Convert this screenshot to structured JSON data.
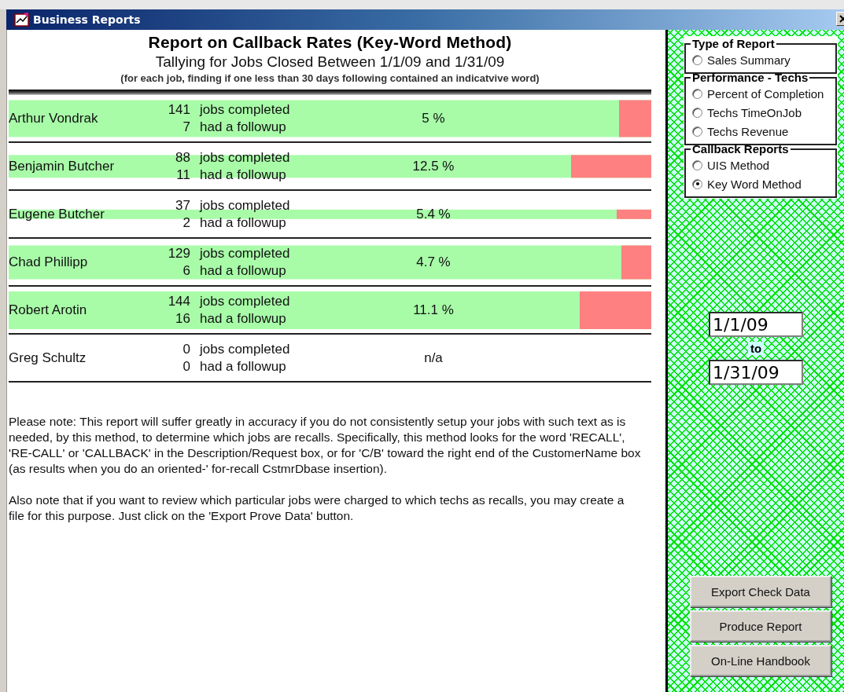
{
  "window": {
    "title": "Business Reports"
  },
  "report": {
    "title": "Report on Callback Rates (Key-Word Method)",
    "subtitle": "Tallying for Jobs Closed Between 1/1/09 and 1/31/09",
    "criteria": "(for each job, finding if one less than 30 days following contained an indicatvive word)"
  },
  "rows": [
    {
      "name": "Arthur Vondrak",
      "jobs": "141",
      "jobs_label": "jobs completed",
      "followups": "7",
      "followups_label": "had a followup",
      "rate": "5 %",
      "level": 0.05
    },
    {
      "name": "Benjamin Butcher",
      "jobs": "88",
      "jobs_label": "jobs completed",
      "followups": "11",
      "followups_label": "had a followup",
      "rate": "12.5 %",
      "level": 0.125
    },
    {
      "name": "Eugene Butcher",
      "jobs": "37",
      "jobs_label": "jobs completed",
      "followups": "2",
      "followups_label": "had a followup",
      "rate": "5.4 %",
      "level": 0.054
    },
    {
      "name": "Chad Phillipp",
      "jobs": "129",
      "jobs_label": "jobs completed",
      "followups": "6",
      "followups_label": "had a followup",
      "rate": "4.7 %",
      "level": 0.047
    },
    {
      "name": "Robert Arotin",
      "jobs": "144",
      "jobs_label": "jobs completed",
      "followups": "16",
      "followups_label": "had a followup",
      "rate": "11.1 %",
      "level": 0.111
    },
    {
      "name": "Greg Schultz",
      "jobs": "0",
      "jobs_label": "jobs completed",
      "followups": "0",
      "followups_label": "had a followup",
      "rate": "n/a"
    }
  ],
  "notes": [
    "Please note: This report will suffer greatly in accuracy if you do not consistently setup your jobs with such text as is needed, by this method, to determine which jobs are recalls.  Specifically, this method looks for the word 'RECALL', 'RE-CALL' or 'CALLBACK' in the Description/Request box, or for 'C/B' toward the right end of the CustomerName box (as results when you do an oriented-' for-recall CstmrDbase insertion).",
    "Also note that if you want to review which particular jobs were charged to which techs as recalls, you may create a file for this purpose.  Just click on the 'Export Prove Data' button."
  ],
  "panel": {
    "groups": [
      {
        "title": "Type of Report",
        "options": [
          {
            "label": "Sales Summary",
            "selected": false
          }
        ]
      },
      {
        "title": "Performance - Techs",
        "options": [
          {
            "label": "Percent of Completion",
            "selected": false
          },
          {
            "label": "Techs TimeOnJob",
            "selected": false
          },
          {
            "label": "Techs Revenue",
            "selected": false
          }
        ]
      },
      {
        "title": "Callback Reports",
        "options": [
          {
            "label": "UIS Method",
            "selected": false
          },
          {
            "label": "Key Word Method",
            "selected": true
          }
        ]
      }
    ],
    "date_from": "1/1/09",
    "to_label": "to",
    "date_to": "1/31/09",
    "buttons": [
      "Export Check Data",
      "Produce Report",
      "On-Line Handbook"
    ]
  }
}
